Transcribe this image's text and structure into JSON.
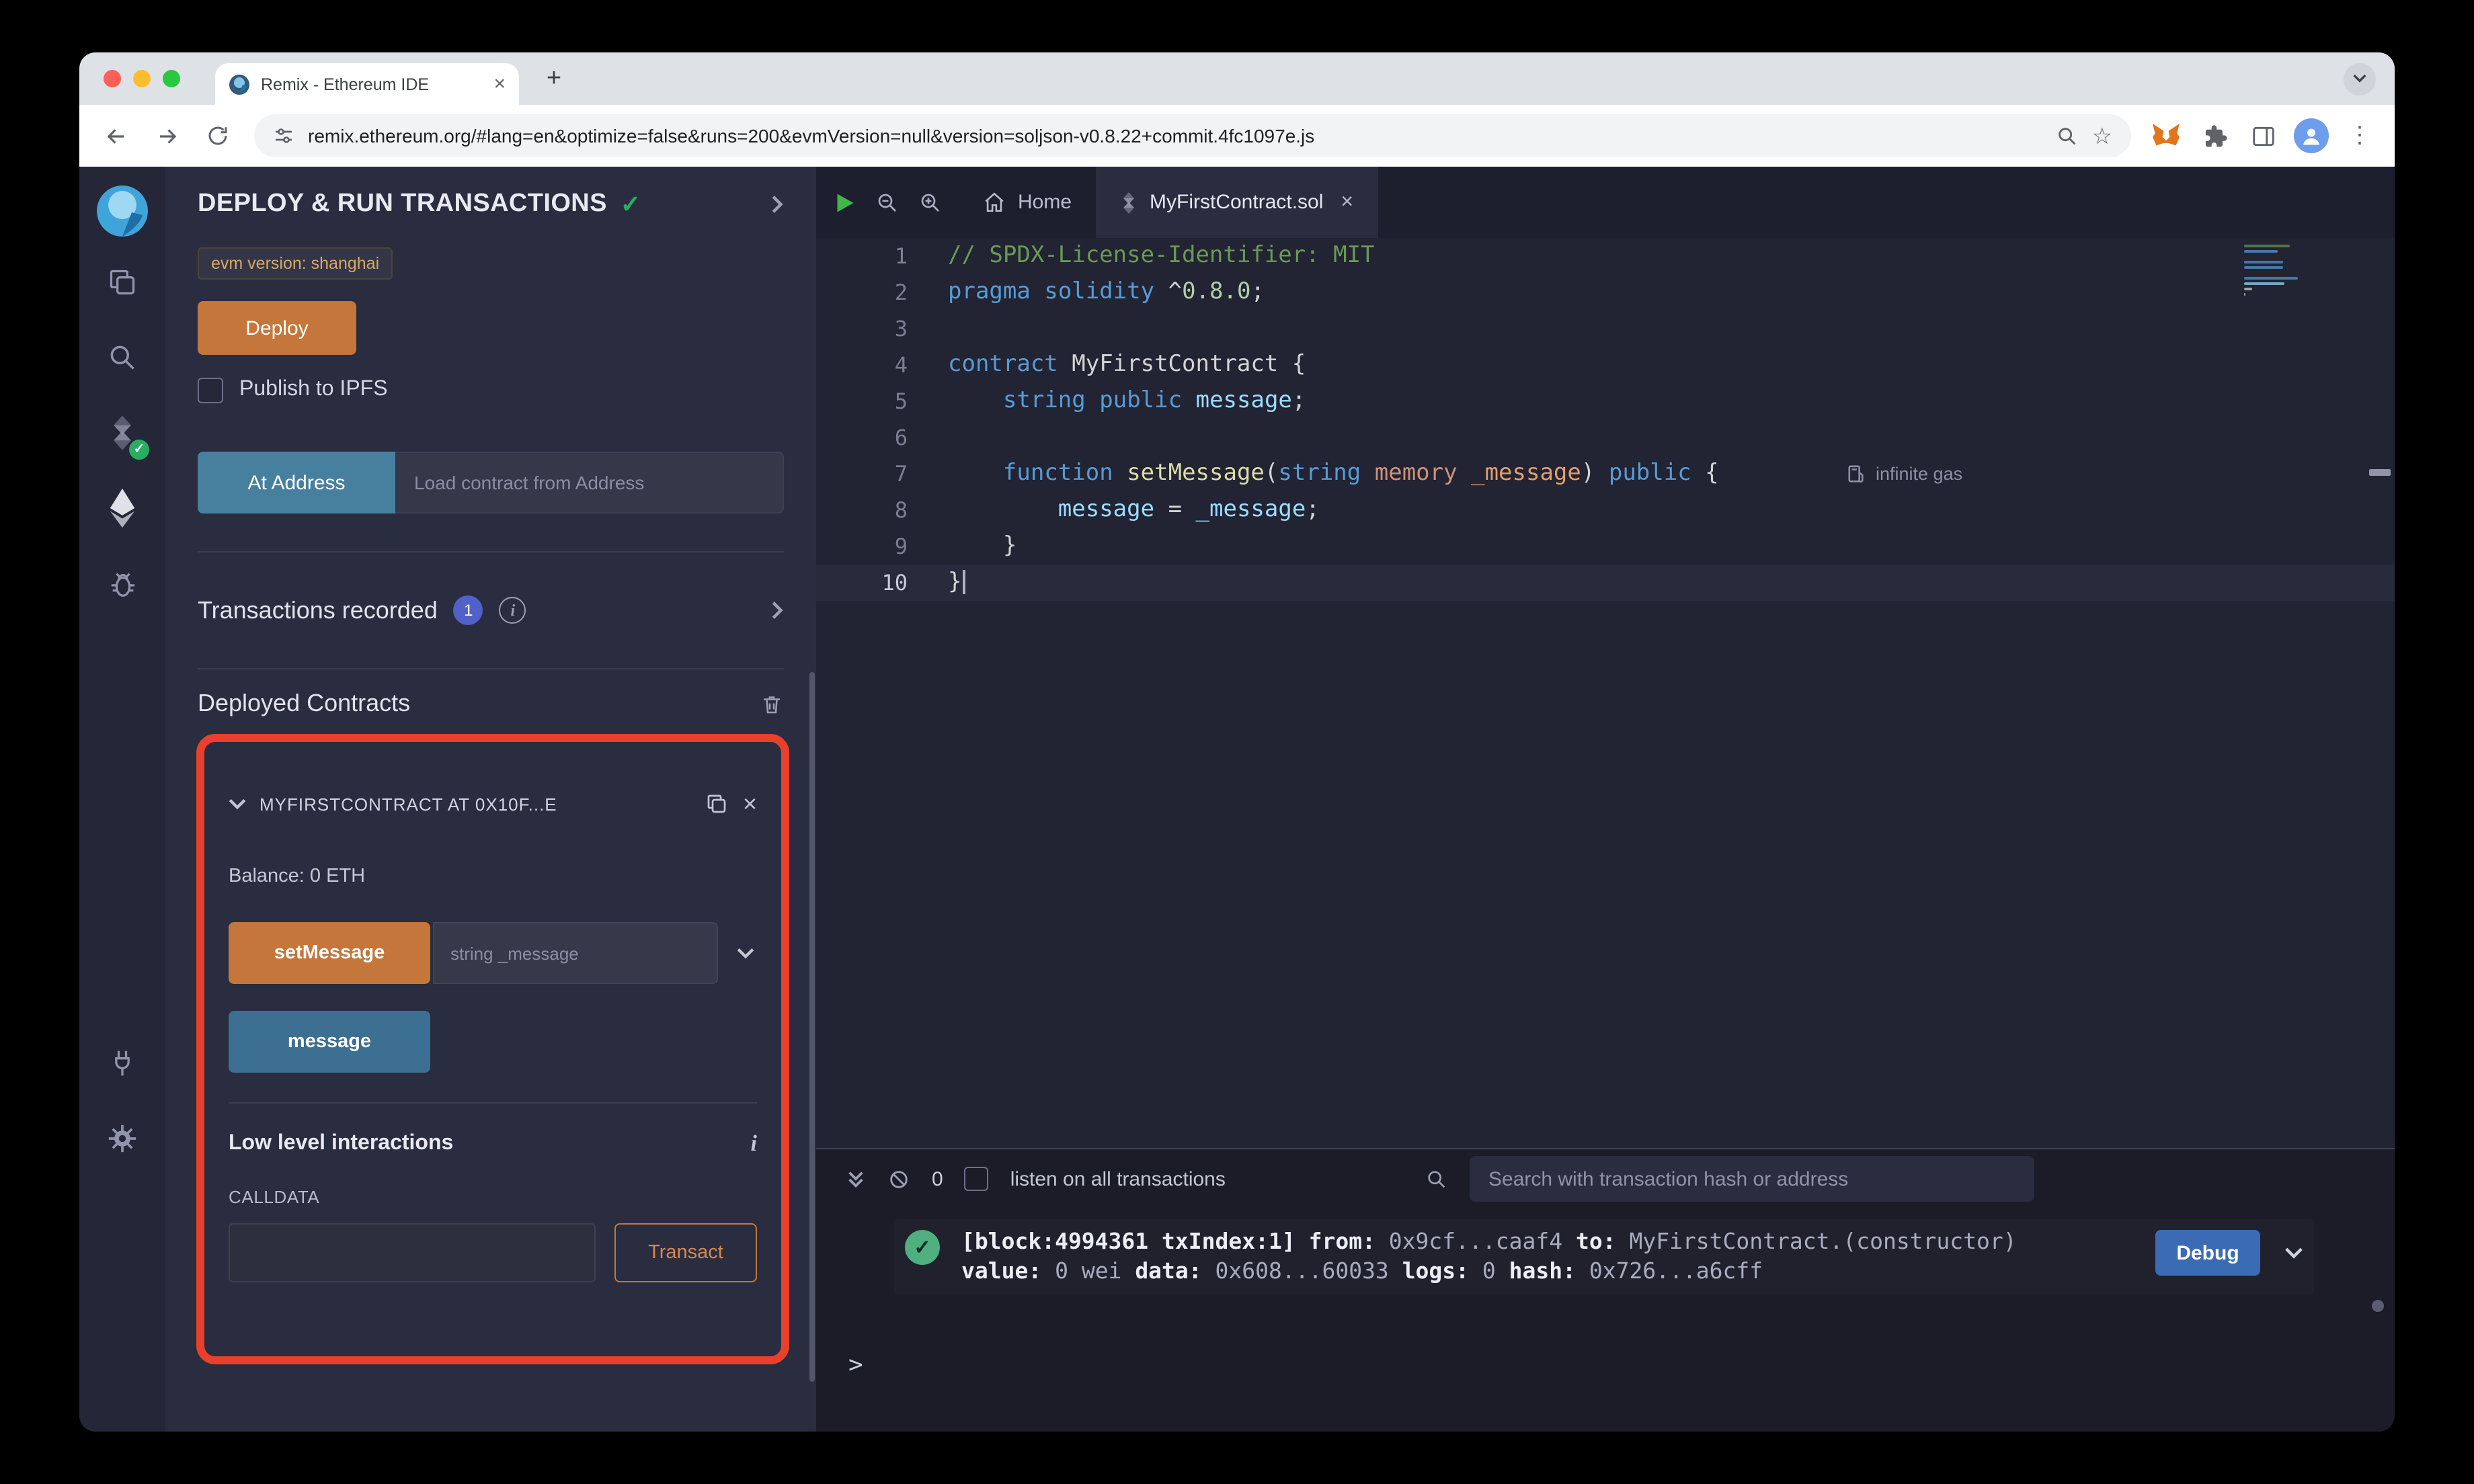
{
  "browser": {
    "tab_title": "Remix - Ethereum IDE",
    "url": "remix.ethereum.org/#lang=en&optimize=false&runs=200&evmVersion=null&version=soljson-v0.8.22+commit.4fc1097e.js"
  },
  "icons": {
    "close": "×",
    "check": "✓",
    "kebab": "⋮",
    "star": "☆",
    "plus": "+",
    "info_i": "i"
  },
  "side_panel": {
    "title": "DEPLOY & RUN TRANSACTIONS",
    "evm_badge": "evm version: shanghai",
    "deploy_button": "Deploy",
    "publish_checkbox": "Publish to IPFS",
    "at_address_button": "At Address",
    "at_address_placeholder": "Load contract from Address",
    "transactions_recorded_label": "Transactions recorded",
    "transactions_count": "1",
    "deployed_contracts_title": "Deployed Contracts",
    "contract": {
      "header": "MYFIRSTCONTRACT AT 0X10F...E",
      "balance": "Balance: 0 ETH",
      "set_message_button": "setMessage",
      "set_message_placeholder": "string _message",
      "message_button": "message",
      "low_level_title": "Low level interactions",
      "calldata_label": "CALLDATA",
      "transact_button": "Transact"
    }
  },
  "editor": {
    "home_tab": "Home",
    "file_tab": "MyFirstContract.sol",
    "gas_hint": "infinite gas",
    "current_line": 10,
    "code_lines": [
      [
        {
          "t": "// SPDX-License-Identifier: MIT",
          "c": "cm"
        }
      ],
      [
        {
          "t": "pragma",
          "c": "kw"
        },
        {
          "t": " ",
          "c": "pl"
        },
        {
          "t": "solidity",
          "c": "kw"
        },
        {
          "t": " ^",
          "c": "pl"
        },
        {
          "t": "0.8.0",
          "c": "num"
        },
        {
          "t": ";",
          "c": "pl"
        }
      ],
      [],
      [
        {
          "t": "contract",
          "c": "kw"
        },
        {
          "t": " MyFirstContract {",
          "c": "pl"
        }
      ],
      [
        {
          "t": "    ",
          "c": "pl"
        },
        {
          "t": "string",
          "c": "kw"
        },
        {
          "t": " ",
          "c": "pl"
        },
        {
          "t": "public",
          "c": "kw"
        },
        {
          "t": " ",
          "c": "pl"
        },
        {
          "t": "message",
          "c": "var"
        },
        {
          "t": ";",
          "c": "pl"
        }
      ],
      [],
      [
        {
          "t": "    ",
          "c": "pl"
        },
        {
          "t": "function",
          "c": "kw"
        },
        {
          "t": " ",
          "c": "pl"
        },
        {
          "t": "setMessage",
          "c": "fn"
        },
        {
          "t": "(",
          "c": "pl"
        },
        {
          "t": "string",
          "c": "kw"
        },
        {
          "t": " ",
          "c": "pl"
        },
        {
          "t": "memory",
          "c": "mod"
        },
        {
          "t": " ",
          "c": "pl"
        },
        {
          "t": "_message",
          "c": "param"
        },
        {
          "t": ") ",
          "c": "pl"
        },
        {
          "t": "public",
          "c": "kw"
        },
        {
          "t": " {",
          "c": "pl"
        }
      ],
      [
        {
          "t": "        ",
          "c": "pl"
        },
        {
          "t": "message",
          "c": "var"
        },
        {
          "t": " = ",
          "c": "pl"
        },
        {
          "t": "_message",
          "c": "var"
        },
        {
          "t": ";",
          "c": "pl"
        }
      ],
      [
        {
          "t": "    }",
          "c": "pl"
        }
      ],
      [
        {
          "t": "}",
          "c": "pl"
        }
      ]
    ]
  },
  "terminal": {
    "pending_count": "0",
    "listen_label": "listen on all transactions",
    "search_placeholder": "Search with transaction hash or address",
    "debug_button": "Debug",
    "prompt": ">",
    "log_line1": [
      {
        "t": "[block:4994361 txIndex:1]",
        "b": true
      },
      {
        "t": " ",
        "b": false
      },
      {
        "t": "from:",
        "b": true
      },
      {
        "t": " 0x9cf...caaf4 ",
        "b": false
      },
      {
        "t": "to:",
        "b": true
      },
      {
        "t": " MyFirstContract.(constructor)",
        "b": false
      }
    ],
    "log_line2": [
      {
        "t": "value:",
        "b": true
      },
      {
        "t": " 0 wei ",
        "b": false
      },
      {
        "t": "data:",
        "b": true
      },
      {
        "t": " 0x608...60033 ",
        "b": false
      },
      {
        "t": "logs:",
        "b": true
      },
      {
        "t": " 0 ",
        "b": false
      },
      {
        "t": "hash:",
        "b": true
      },
      {
        "t": " 0x726...a6cff",
        "b": false
      }
    ]
  }
}
